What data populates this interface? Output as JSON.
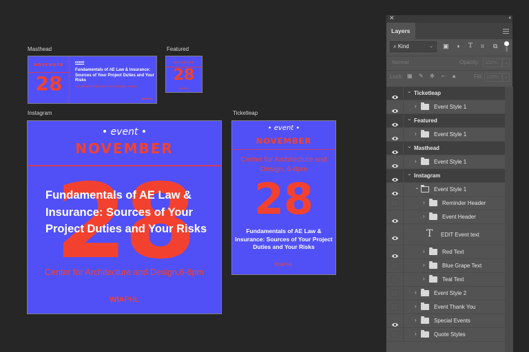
{
  "canvas": {
    "colors": {
      "background": "#5150f6",
      "accent": "#f2422f",
      "text": "#ffffff"
    },
    "artboards": {
      "masthead": {
        "label": "Masthead",
        "month": "NOVEMBER",
        "day": "28",
        "event_tag": "event",
        "title": "Fundamentals of AE Law & Insurance: Sources of Your Project Duties and Your Risks",
        "venue": "Center for Architecture and Design, 6-8pm",
        "org": "WIAPHL"
      },
      "featured": {
        "label": "Featured",
        "month": "NOVEMBER",
        "day": "28",
        "org": "WIAPHL"
      },
      "instagram": {
        "label": "Instagram",
        "event_tag": "• event •",
        "month": "NOVEMBER",
        "day": "28",
        "title": "Fundamentals of AE Law & Insurance: Sources of Your Project Duties and Your Risks",
        "venue": "Center for Architecture and Design,6-8pm",
        "org_bold": "WIA",
        "org_light": "PHL"
      },
      "ticketleap": {
        "label": "Ticketleap",
        "event_tag": "• event •",
        "month": "NOVEMBER",
        "venue": "Center for Architecture and Design, 6-8pm",
        "day": "28",
        "title": "Fundamentals of AE Law & Insurance: Sources of Your Project Duties and Your Risks",
        "org": "WIAPHL"
      }
    }
  },
  "layers_panel": {
    "tab": "Layers",
    "filter_kind": "Kind",
    "filter_icons": [
      "image-filter-icon",
      "adjustment-filter-icon",
      "type-filter-icon",
      "shape-filter-icon",
      "smart-object-filter-icon"
    ],
    "blend_mode": "Normal",
    "opacity_label": "Opacity:",
    "opacity_value": "100%",
    "lock_label": "Lock:",
    "fill_label": "Fill:",
    "fill_value": "100%",
    "layers": [
      {
        "name": "Ticketleap",
        "type": "artboard",
        "visible": true,
        "expanded": true,
        "depth": 0
      },
      {
        "name": "Event Style 1",
        "type": "folder",
        "visible": true,
        "expanded": false,
        "depth": 1
      },
      {
        "name": "Featured",
        "type": "artboard",
        "visible": true,
        "expanded": true,
        "depth": 0
      },
      {
        "name": "Event Style 1",
        "type": "folder",
        "visible": true,
        "expanded": false,
        "depth": 1
      },
      {
        "name": "Masthead",
        "type": "artboard",
        "visible": true,
        "expanded": true,
        "depth": 0
      },
      {
        "name": "Event Style 1",
        "type": "folder",
        "visible": true,
        "expanded": false,
        "depth": 1
      },
      {
        "name": "Instagram",
        "type": "artboard",
        "visible": true,
        "expanded": true,
        "depth": 0
      },
      {
        "name": "Event Style 1",
        "type": "folder",
        "visible": true,
        "expanded": true,
        "depth": 1
      },
      {
        "name": "Reminder Header",
        "type": "folder",
        "visible": false,
        "expanded": false,
        "depth": 2
      },
      {
        "name": "Event Header",
        "type": "folder",
        "visible": true,
        "expanded": false,
        "depth": 2
      },
      {
        "name": "EDIT Event text",
        "type": "text",
        "visible": true,
        "depth": 2
      },
      {
        "name": "Red Text",
        "type": "folder",
        "visible": true,
        "expanded": false,
        "depth": 2
      },
      {
        "name": "Blue Grape Text",
        "type": "folder",
        "visible": false,
        "expanded": false,
        "depth": 2
      },
      {
        "name": "Teal Text",
        "type": "folder",
        "visible": false,
        "expanded": false,
        "depth": 2
      },
      {
        "name": "Event Style 2",
        "type": "folder",
        "visible": false,
        "expanded": false,
        "depth": 1
      },
      {
        "name": "Event Thank You",
        "type": "folder",
        "visible": false,
        "expanded": false,
        "depth": 1
      },
      {
        "name": "Special Events",
        "type": "folder",
        "visible": true,
        "expanded": false,
        "depth": 1
      },
      {
        "name": "Quote Styles",
        "type": "folder",
        "visible": false,
        "expanded": false,
        "depth": 1
      }
    ]
  }
}
